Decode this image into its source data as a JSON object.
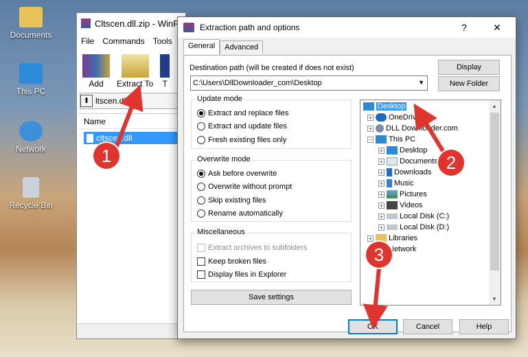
{
  "desktop": {
    "icons": [
      {
        "label": "Documents",
        "icon": "folder-icon"
      },
      {
        "label": "This PC",
        "icon": "computer-icon"
      },
      {
        "label": "Network",
        "icon": "network-icon"
      },
      {
        "label": "Recycle Bin",
        "icon": "recycle-bin-icon"
      }
    ]
  },
  "winrar": {
    "title": "Cltscen.dll.zip - WinR",
    "menu": [
      "File",
      "Commands",
      "Tools"
    ],
    "tools": [
      {
        "label": "Add",
        "icon": "add-archive-icon"
      },
      {
        "label": "Extract To",
        "icon": "extract-icon"
      },
      {
        "label": "T",
        "icon": "test-icon"
      }
    ],
    "path": "ltscen.dll.z",
    "column_name": "Name",
    "file": "cltscen.dll"
  },
  "dialog": {
    "title": "Extraction path and options",
    "help": "?",
    "close": "✕",
    "tabs": [
      "General",
      "Advanced"
    ],
    "dest_label": "Destination path (will be created if does not exist)",
    "dest_value": "C:\\Users\\DllDownloader_com\\Desktop",
    "display_button": "Display",
    "new_folder_button": "New Folder",
    "update_mode": {
      "title": "Update mode",
      "options": [
        "Extract and replace files",
        "Extract and update files",
        "Fresh existing files only"
      ],
      "selected": 0
    },
    "overwrite_mode": {
      "title": "Overwrite mode",
      "options": [
        "Ask before overwrite",
        "Overwrite without prompt",
        "Skip existing files",
        "Rename automatically"
      ],
      "selected": 0
    },
    "misc": {
      "title": "Miscellaneous",
      "options": [
        "Extract archives to subfolders",
        "Keep broken files",
        "Display files in Explorer"
      ]
    },
    "save_button": "Save settings",
    "tree": [
      {
        "label": "Desktop",
        "icon": "desktop-icon",
        "selected": true
      },
      {
        "label": "OneDrive",
        "icon": "onedrive-icon"
      },
      {
        "label": "DLL Downloader.com",
        "icon": "user-icon"
      },
      {
        "label": "This PC",
        "icon": "computer-icon"
      },
      {
        "label": "Desktop",
        "icon": "desktop-icon"
      },
      {
        "label": "Documents",
        "icon": "documents-icon"
      },
      {
        "label": "Downloads",
        "icon": "downloads-icon"
      },
      {
        "label": "Music",
        "icon": "music-icon"
      },
      {
        "label": "Pictures",
        "icon": "pictures-icon"
      },
      {
        "label": "Videos",
        "icon": "videos-icon"
      },
      {
        "label": "Local Disk (C:)",
        "icon": "drive-icon"
      },
      {
        "label": "Local Disk (D:)",
        "icon": "drive-icon"
      },
      {
        "label": "Libraries",
        "icon": "libraries-icon"
      },
      {
        "label": "Network",
        "icon": "network-icon"
      }
    ],
    "ok_button": "OK",
    "cancel_button": "Cancel",
    "help_button": "Help"
  },
  "annotations": [
    "1",
    "2",
    "3"
  ],
  "colors": {
    "marker": "#e0342f",
    "selection": "#3399ff",
    "accent": "#0078d7"
  }
}
